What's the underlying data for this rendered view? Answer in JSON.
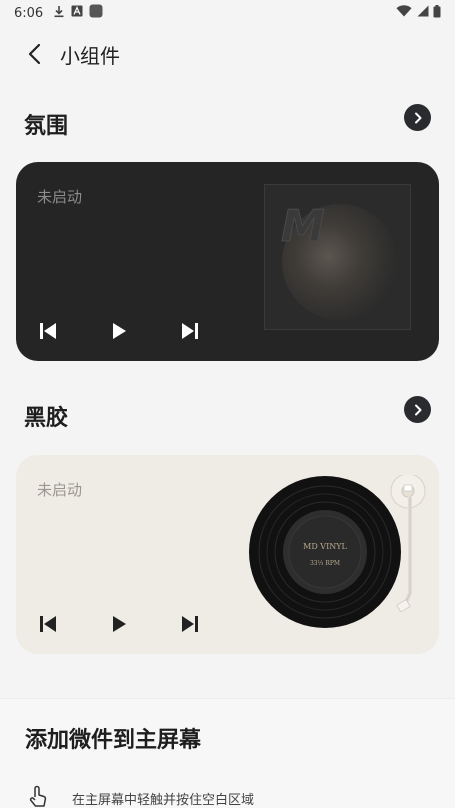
{
  "status_bar": {
    "time": "6:06",
    "icons": [
      "download-icon",
      "font-icon",
      "square-app-icon",
      "wifi-icon",
      "signal-icon",
      "battery-icon"
    ]
  },
  "header": {
    "title": "小组件"
  },
  "sections": [
    {
      "title": "氛围",
      "card": {
        "theme": "dark",
        "status": "未启动",
        "art_letter": "M"
      }
    },
    {
      "title": "黑胶",
      "card": {
        "theme": "light",
        "status": "未启动",
        "record_title": "MD VINYL",
        "record_speed": "33⅓ RPM"
      }
    }
  ],
  "add_widget": {
    "title": "添加微件到主屏幕",
    "hint": "在主屏幕中轻触并按住空白区域"
  },
  "colors": {
    "dark_card": "#252525",
    "light_card": "#efebe5",
    "accent_button": "#2a2b2f"
  }
}
